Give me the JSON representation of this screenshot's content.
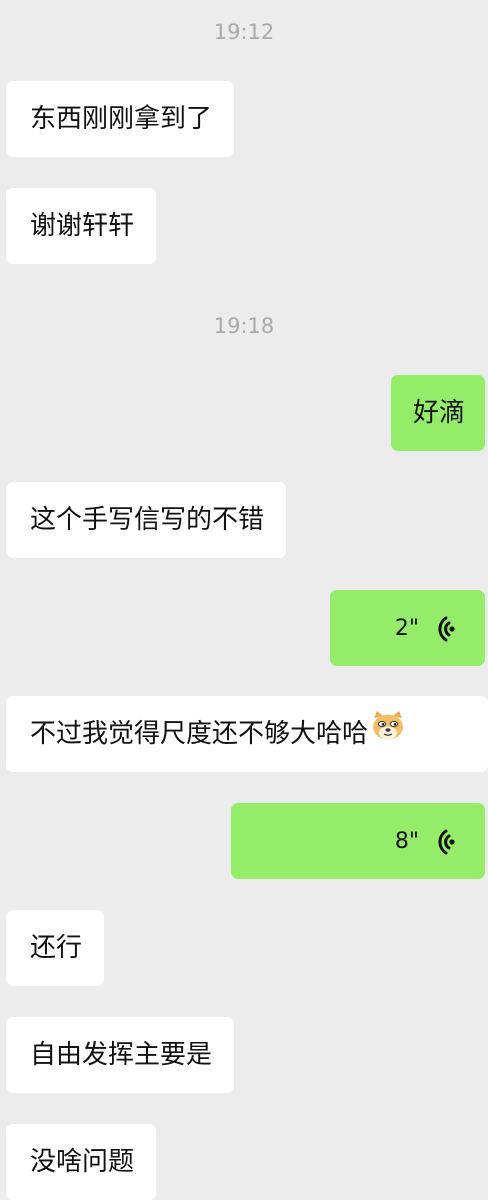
{
  "messages": [
    {
      "type": "time",
      "text": "19:12"
    },
    {
      "type": "incoming",
      "text": "东西刚刚拿到了"
    },
    {
      "type": "incoming",
      "text": "谢谢轩轩"
    },
    {
      "type": "time",
      "text": "19:18"
    },
    {
      "type": "outgoing",
      "text": "好滴"
    },
    {
      "type": "incoming",
      "text": "这个手写信写的不错"
    },
    {
      "type": "outgoing-voice",
      "duration": "2\"",
      "icon": "voice-wave-icon"
    },
    {
      "type": "incoming",
      "text": "不过我觉得尺度还不够大哈哈",
      "emoji": "doge-emoji-icon"
    },
    {
      "type": "outgoing-voice",
      "duration": "8\"",
      "icon": "voice-wave-icon"
    },
    {
      "type": "incoming",
      "text": "还行"
    },
    {
      "type": "incoming",
      "text": "自由发挥主要是"
    },
    {
      "type": "incoming",
      "text": "没啥问题"
    }
  ],
  "colors": {
    "background": "#ececec",
    "incoming_bubble": "#ffffff",
    "outgoing_bubble": "#95ec69",
    "timestamp": "#a9a9a9"
  }
}
